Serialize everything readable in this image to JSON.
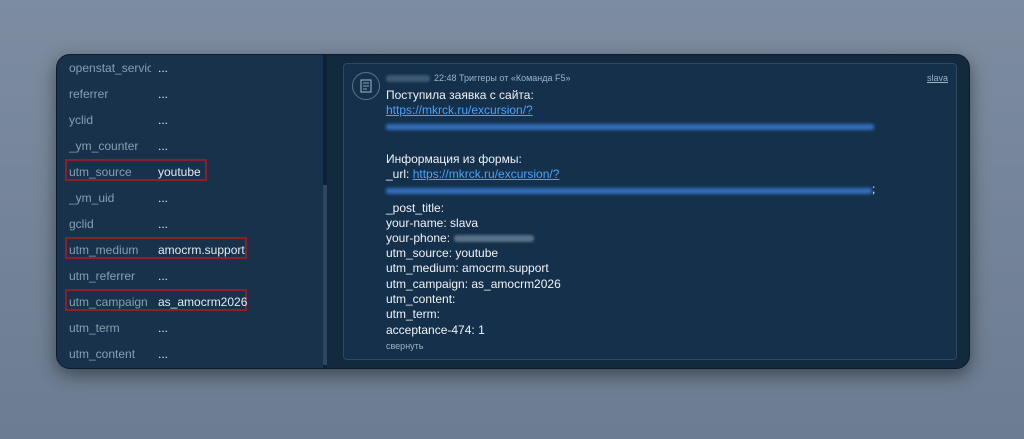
{
  "fields": [
    {
      "name": "openstat_servic",
      "value": "..."
    },
    {
      "name": "referrer",
      "value": "..."
    },
    {
      "name": "yclid",
      "value": "..."
    },
    {
      "name": "_ym_counter",
      "value": "..."
    },
    {
      "name": "utm_source",
      "value": "youtube"
    },
    {
      "name": "_ym_uid",
      "value": "..."
    },
    {
      "name": "gclid",
      "value": "..."
    },
    {
      "name": "utm_medium",
      "value": "amocrm.support"
    },
    {
      "name": "utm_referrer",
      "value": "..."
    },
    {
      "name": "utm_campaign",
      "value": "as_amocrm2026"
    },
    {
      "name": "utm_term",
      "value": "..."
    },
    {
      "name": "utm_content",
      "value": "..."
    }
  ],
  "message": {
    "header": "22:48 Триггеры от «Команда F5»",
    "author": "slava",
    "line1": "Поступила заявка с сайта:",
    "link1": "https://mkrck.ru/excursion/?",
    "form_heading": "Информация из формы:",
    "url_label": "_url: ",
    "link2": "https://mkrck.ru/excursion/?",
    "link2_suffix": ";",
    "post_title": "_post_title:",
    "your_name": "your-name: slava",
    "your_phone": "your-phone:",
    "utm_source": "utm_source: youtube",
    "utm_medium": "utm_medium: amocrm.support",
    "utm_campaign": "utm_campaign: as_amocrm2026",
    "utm_content": "utm_content:",
    "utm_term": "utm_term:",
    "acceptance": "acceptance-474: 1",
    "collapse": "свернуть"
  }
}
